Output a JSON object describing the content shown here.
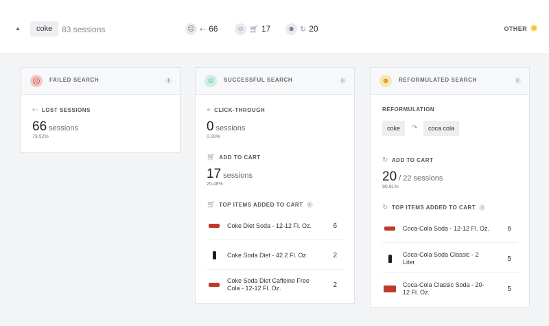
{
  "header": {
    "query": "coke",
    "sessions": "83 sessions",
    "metrics": [
      {
        "icon": "sad-face-icon",
        "sub_icon": "exit-arrow-icon",
        "value": "66"
      },
      {
        "icon": "happy-face-icon",
        "sub_icon": "cart-icon",
        "value": "17"
      },
      {
        "icon": "wink-face-icon",
        "sub_icon": "reformulate-cart-icon",
        "value": "20"
      }
    ],
    "other_label": "OTHER"
  },
  "failed": {
    "title": "FAILED SEARCH",
    "section": "LOST SESSIONS",
    "value": "66",
    "unit": "sessions",
    "pct": "79.52%",
    "color": "#f4c7c7"
  },
  "successful": {
    "title": "SUCCESSFUL SEARCH",
    "click_label": "CLICK-THROUGH",
    "click_value": "0",
    "click_unit": "sessions",
    "click_pct": "0.00%",
    "cart_label": "ADD TO CART",
    "cart_value": "17",
    "cart_unit": "sessions",
    "cart_pct": "20.48%",
    "top_label": "TOP ITEMS ADDED TO CART",
    "items": [
      {
        "name": "Coke Diet Soda - 12-12 Fl. Oz.",
        "count": "6",
        "thumb": "can"
      },
      {
        "name": "Coke Soda Diet - 42.2 Fl. Oz.",
        "count": "2",
        "thumb": "bottle"
      },
      {
        "name": "Coke Soda Diet Caffeine Free Cola - 12-12 Fl. Oz.",
        "count": "2",
        "thumb": "can"
      }
    ],
    "color": "#cdeee4"
  },
  "reformulated": {
    "title": "REFORMULATED SEARCH",
    "reform_label": "REFORMULATION",
    "from": "coke",
    "to": "coca cola",
    "cart_label": "ADD TO CART",
    "cart_value": "20",
    "cart_unit": "/ 22 sessions",
    "cart_pct": "90.91%",
    "top_label": "TOP ITEMS ADDED TO CART",
    "items": [
      {
        "name": "Coca-Cola Soda - 12-12 Fl. Oz.",
        "count": "6",
        "thumb": "can"
      },
      {
        "name": "Coca-Cola Soda Classic - 2 Liter",
        "count": "5",
        "thumb": "bottle"
      },
      {
        "name": "Coca-Cola Classic Soda - 20-12 Fl. Oz.",
        "count": "5",
        "thumb": "box"
      }
    ],
    "color": "#f8e7b5"
  }
}
